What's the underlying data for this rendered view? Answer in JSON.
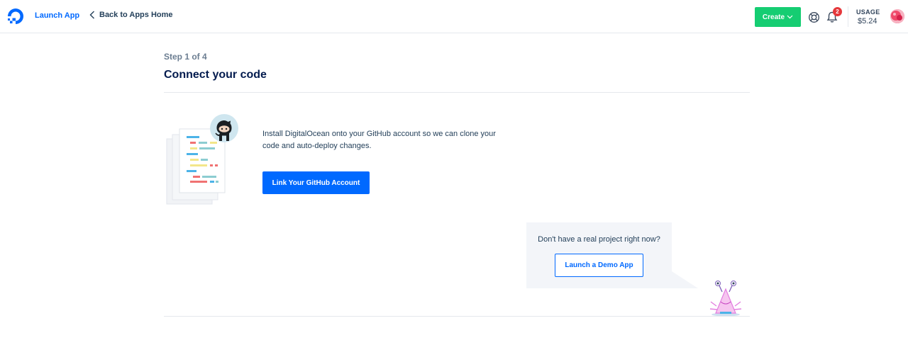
{
  "header": {
    "app_title": "Launch App",
    "back_label": "Back to Apps Home",
    "create_label": "Create",
    "notifications_count": "2",
    "usage_label": "USAGE",
    "usage_value": "$5.24"
  },
  "main": {
    "step": "Step 1 of 4",
    "title": "Connect your code",
    "description": "Install DigitalOcean onto your GitHub account so we can clone your code and auto-deploy changes.",
    "github_button": "Link Your GitHub Account"
  },
  "demo": {
    "prompt": "Don't have a real project right now?",
    "button": "Launch a Demo App"
  },
  "colors": {
    "brand_blue": "#0069ff",
    "create_green": "#15cd72",
    "badge_red": "#e5383b",
    "text_dark": "#031b4e"
  },
  "icons": [
    "digitalocean-logo",
    "chevron-left-icon",
    "chevron-down-icon",
    "help-lifebuoy-icon",
    "bell-icon",
    "avatar",
    "github-octocat-icon",
    "demo-monster-illustration"
  ]
}
